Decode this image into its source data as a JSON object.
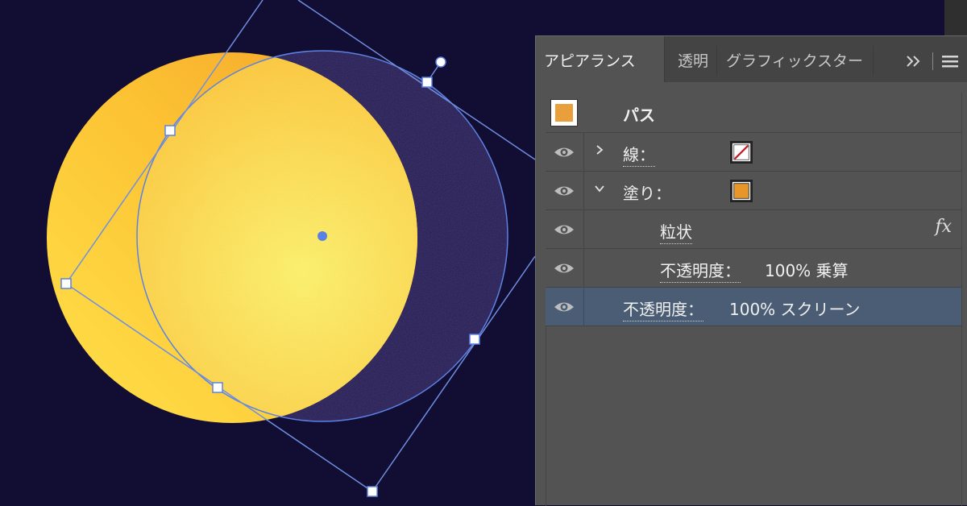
{
  "canvas": {
    "background_color": "#120d33",
    "moon_color": "#ffd43b",
    "shadow_color": "#241b55",
    "selection_color": "#5b82e3"
  },
  "panel": {
    "tabs": [
      {
        "label": "アピアランス",
        "active": true
      },
      {
        "label": "透明",
        "active": false
      },
      {
        "label": "グラフィックスター",
        "active": false
      }
    ],
    "overflow_icon": "double-chevron-right-icon",
    "menu_icon": "hamburger-menu-icon",
    "title": "パス",
    "rows": [
      {
        "label": "線：",
        "expander": "closed",
        "swatch": "none-stroke"
      },
      {
        "label": "塗り：",
        "expander": "open",
        "swatch": "#e8952a"
      },
      {
        "label": "粒状",
        "effect_icon": "fx"
      },
      {
        "label": "不透明度：",
        "value": "100% 乗算"
      },
      {
        "label": "不透明度：",
        "value": "100% スクリーン",
        "selected": true
      }
    ]
  }
}
